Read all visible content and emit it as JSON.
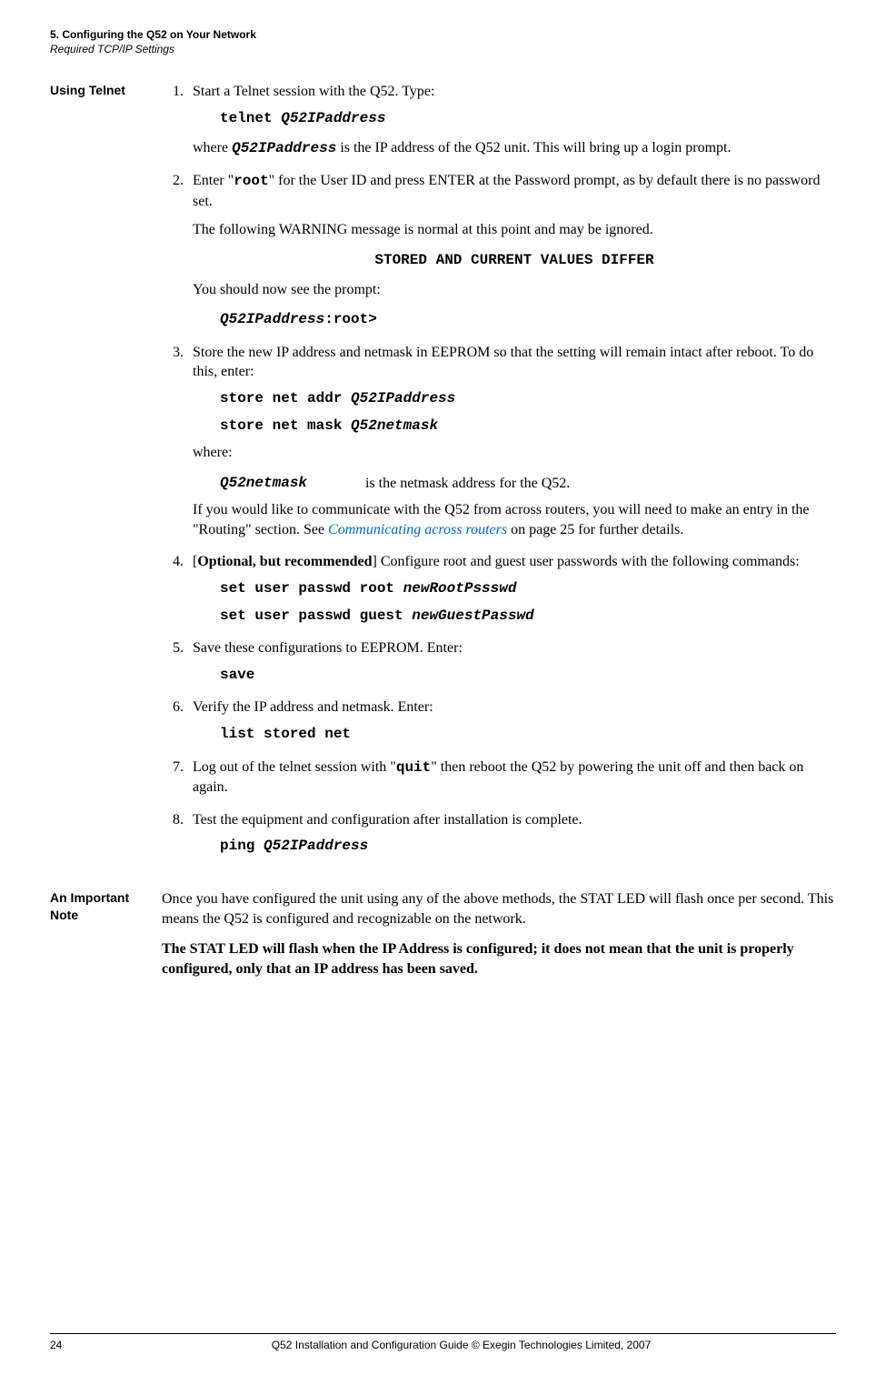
{
  "header": {
    "title": "5. Configuring the Q52 on Your Network",
    "subtitle": "Required TCP/IP Settings"
  },
  "section1": {
    "label": "Using Telnet",
    "step1_intro": "Start a Telnet session with the Q52. Type:",
    "step1_cmd_a": "telnet ",
    "step1_cmd_b": "Q52IPaddress",
    "step1_where_a": "where ",
    "step1_where_b": "Q52IPaddress",
    "step1_where_c": " is the IP address of the Q52 unit. This will bring up a login prompt.",
    "step2_a": "Enter \"",
    "step2_b": "root",
    "step2_c": "\" for the User ID and press ENTER at the Password prompt, as by default there is no password set.",
    "step2_warn": "The following WARNING message is normal at this point and may be ignored.",
    "step2_warn_msg": "STORED AND CURRENT VALUES DIFFER",
    "step2_prompt_intro": "You should now see the prompt:",
    "step2_prompt_a": "Q52IPaddress",
    "step2_prompt_b": ":root>",
    "step3_intro": "Store the new IP address and netmask in EEPROM so that the setting will remain intact after reboot. To do this, enter:",
    "step3_cmd1_a": "store net addr ",
    "step3_cmd1_b": "Q52IPaddress",
    "step3_cmd2_a": "store net mask ",
    "step3_cmd2_b": "Q52netmask",
    "step3_where": "where:",
    "step3_def_term": "Q52netmask",
    "step3_def_desc": "is the netmask address for the Q52.",
    "step3_routing_a": "If you would like to communicate with the Q52 from across routers, you will need to make an entry in the \"Routing\" section. See ",
    "step3_routing_link": "Communicating across routers",
    "step3_routing_b": " on page 25 for further details.",
    "step4_a": "[",
    "step4_b": "Optional, but recommended",
    "step4_c": "] Configure root and guest user passwords with the following commands:",
    "step4_cmd1_a": "set user passwd root ",
    "step4_cmd1_b": "newRootPssswd",
    "step4_cmd2_a": "set user passwd guest ",
    "step4_cmd2_b": "newGuestPasswd",
    "step5_intro": "Save these configurations to EEPROM. Enter:",
    "step5_cmd": "save",
    "step6_intro": "Verify the IP address and netmask. Enter:",
    "step6_cmd": "list stored net",
    "step7_a": "Log out of the telnet session with \"",
    "step7_b": "quit",
    "step7_c": "\" then reboot the Q52 by powering the unit off and then back on again.",
    "step8_intro": "Test the equipment and configuration after installation is complete.",
    "step8_cmd_a": "ping ",
    "step8_cmd_b": "Q52IPaddress"
  },
  "section2": {
    "label": "An Important Note",
    "p1": "Once you have configured the unit using any of the above methods, the STAT LED will flash once per second. This means the Q52 is configured and recognizable on the network.",
    "p2": "The STAT LED will flash when the IP Address is configured; it does not mean that the unit is properly configured, only that an IP address has been saved."
  },
  "footer": {
    "page": "24",
    "text": "Q52 Installation and Configuration Guide  © Exegin Technologies Limited, 2007"
  }
}
